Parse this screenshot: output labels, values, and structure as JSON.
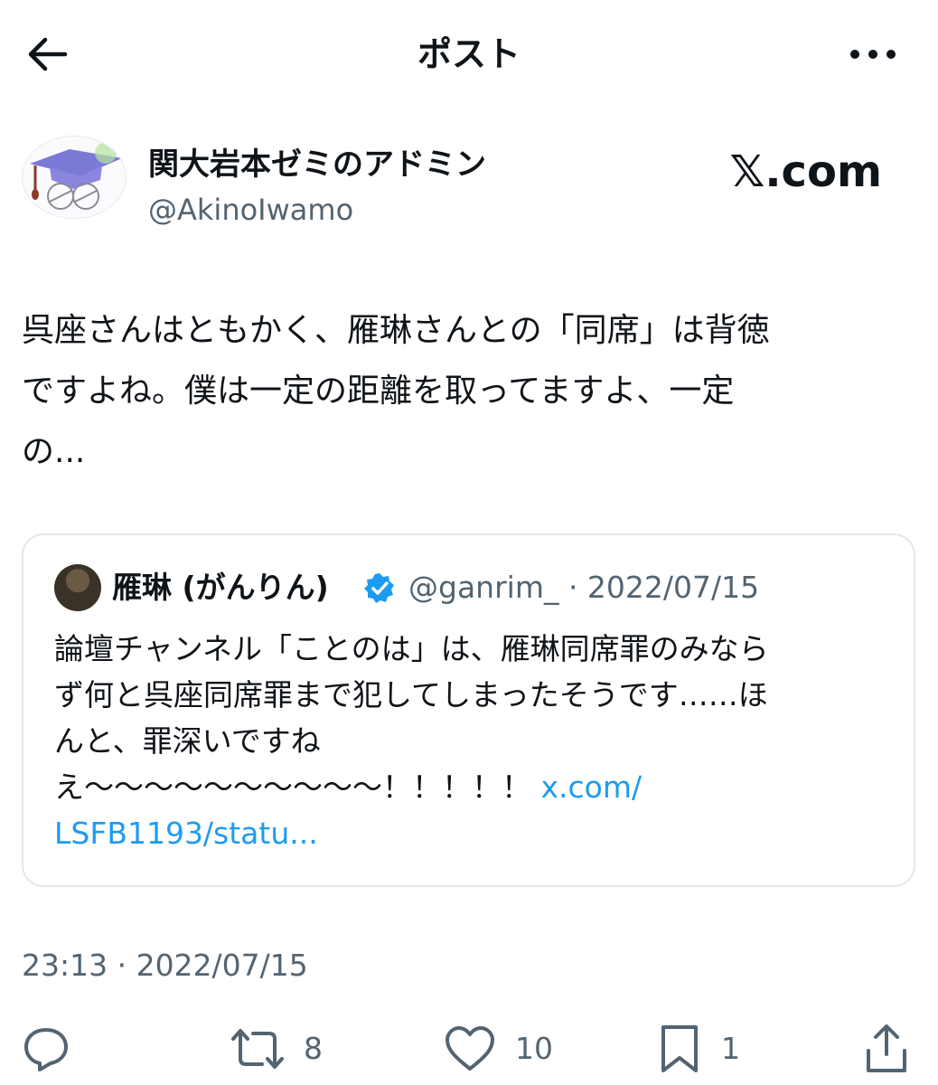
{
  "header": {
    "title": "ポスト",
    "back_icon": "arrow-left-icon",
    "more_icon": "more-horizontal-icon"
  },
  "author": {
    "name": "関大岩本ゼミのアドミン",
    "handle": "@AkinoIwamo",
    "avatar_icon": "graduation-cap-avatar"
  },
  "brand": "𝕏.com",
  "post": {
    "text": "呉座さんはともかく、雁琳さんとの「同席」は背徳\nですよね。僕は一定の距離を取ってますよ、一定\nの..."
  },
  "quote": {
    "name": "雁琳 (がんりん)",
    "verified_icon": "verified-badge-icon",
    "handle_date": "@ganrim_ · 2022/07/15",
    "text": "論壇チャンネル「ことのは」は、雁琳同席罪のみなら\nず何と呉座同席罪まで犯してしまったそうです……ほ\nんと、罪深いですね\nえ～～～～～～～～～～！！！！！ ",
    "link_line1": "x.com/",
    "link_line2": "LSFB1193/statu..."
  },
  "timestamp": "23:13 · 2022/07/15",
  "actions": {
    "reply": {
      "icon": "reply-icon",
      "count": ""
    },
    "repost": {
      "icon": "repost-icon",
      "count": "8"
    },
    "like": {
      "icon": "heart-icon",
      "count": "10"
    },
    "bookmark": {
      "icon": "bookmark-icon",
      "count": "1"
    },
    "share": {
      "icon": "share-icon",
      "count": ""
    }
  },
  "colors": {
    "text": "#0f1419",
    "secondary": "#536471",
    "link": "#1d9bf0",
    "border": "#e3e8ec"
  }
}
